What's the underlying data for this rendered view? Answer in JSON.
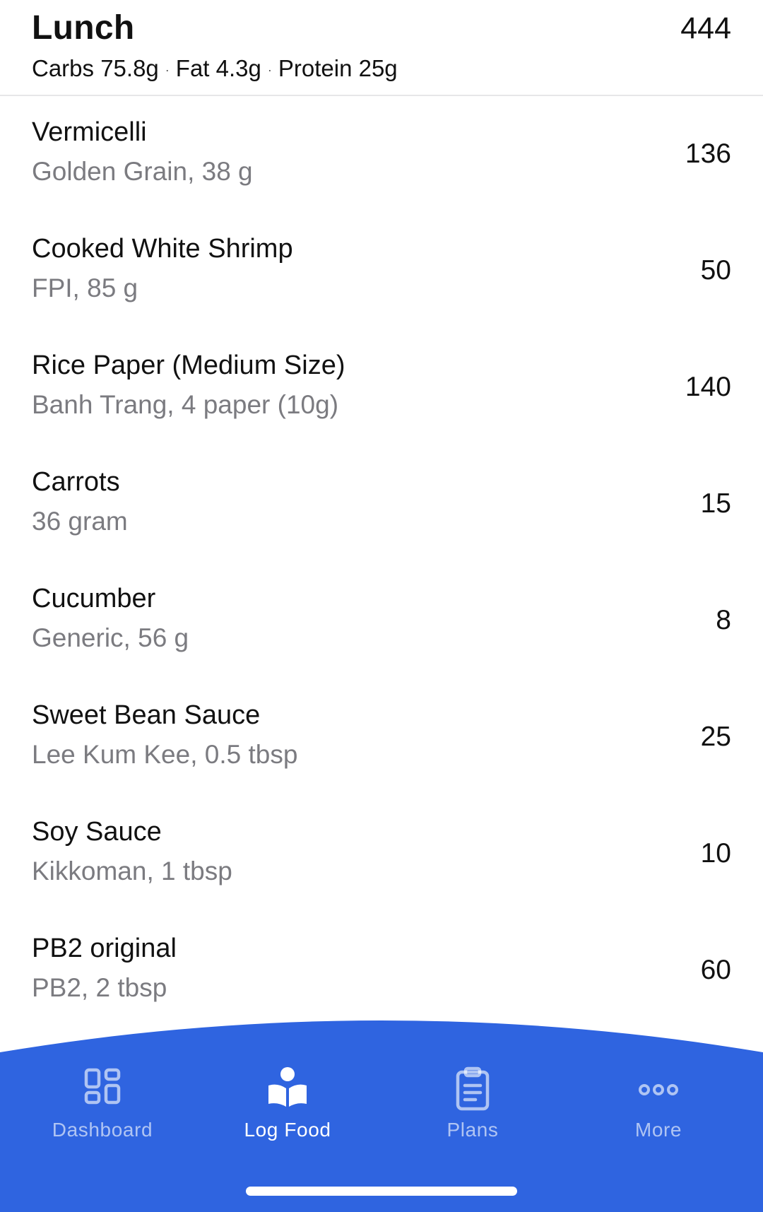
{
  "meal": {
    "title": "Lunch",
    "total_calories": "444",
    "macros": {
      "carbs": "Carbs 75.8g",
      "fat": "Fat 4.3g",
      "protein": "Protein 25g",
      "separator": "·"
    }
  },
  "foods": [
    {
      "name": "Vermicelli",
      "detail": "Golden Grain, 38 g",
      "calories": "136"
    },
    {
      "name": "Cooked White Shrimp",
      "detail": "FPI, 85 g",
      "calories": "50"
    },
    {
      "name": "Rice Paper (Medium Size)",
      "detail": "Banh Trang, 4 paper (10g)",
      "calories": "140"
    },
    {
      "name": "Carrots",
      "detail": "36 gram",
      "calories": "15"
    },
    {
      "name": "Cucumber",
      "detail": "Generic, 56 g",
      "calories": "8"
    },
    {
      "name": "Sweet Bean Sauce",
      "detail": "Lee Kum Kee, 0.5 tbsp",
      "calories": "25"
    },
    {
      "name": "Soy Sauce",
      "detail": "Kikkoman, 1 tbsp",
      "calories": "10"
    },
    {
      "name": "PB2 original",
      "detail": "PB2, 2 tbsp",
      "calories": "60"
    }
  ],
  "tabbar": {
    "tabs": [
      {
        "label": "Dashboard",
        "icon": "dashboard-grid-icon",
        "active": false
      },
      {
        "label": "Log Food",
        "icon": "log-food-book-icon",
        "active": true
      },
      {
        "label": "Plans",
        "icon": "clipboard-icon",
        "active": false
      },
      {
        "label": "More",
        "icon": "more-dots-icon",
        "active": false
      }
    ]
  },
  "colors": {
    "tabbar_background": "#2F64E0",
    "secondary_text": "#7B7B80",
    "divider": "#E6E6E8"
  }
}
